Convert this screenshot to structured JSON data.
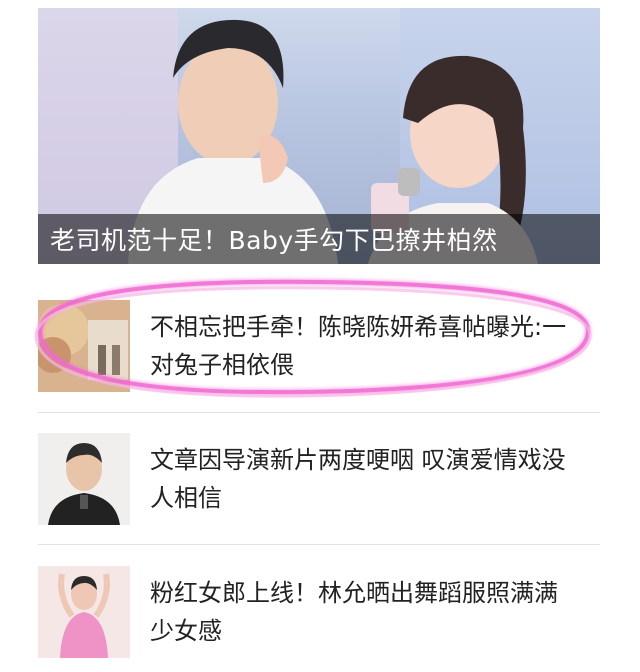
{
  "hero": {
    "caption": "老司机范十足！Baby手勾下巴撩井柏然"
  },
  "articles": [
    {
      "title": "不相忘把手牵！陈晓陈妍希喜帖曝光:一对兔子相依偎"
    },
    {
      "title": "文章因导演新片两度哽咽 叹演爱情戏没人相信"
    },
    {
      "title": "粉红女郎上线！林允晒出舞蹈服照满满少女感"
    }
  ],
  "colors": {
    "highlight": "#f06ad2",
    "caption_bg": "#000000",
    "text": "#222222"
  }
}
